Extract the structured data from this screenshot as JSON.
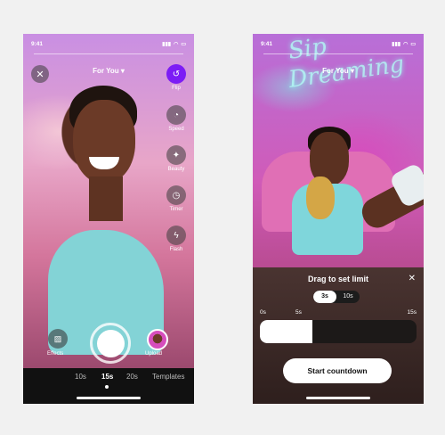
{
  "colors": {
    "accent": "#7c1cf5",
    "duration_bar": "#111111",
    "sheet_bg": "#3a2826"
  },
  "left_screen": {
    "status_time": "9:41",
    "feed_title": "For You",
    "close_icon": "close-icon",
    "tools": [
      {
        "label": "Flip",
        "icon": "flip-camera-icon",
        "glyph": "↺",
        "active": true
      },
      {
        "label": "Speed",
        "icon": "speed-gauge-icon",
        "glyph": "◔",
        "active": false
      },
      {
        "label": "Beauty",
        "icon": "magic-wand-icon",
        "glyph": "✦",
        "active": false
      },
      {
        "label": "Timer",
        "icon": "timer-icon",
        "glyph": "◷",
        "active": false
      },
      {
        "label": "Flash",
        "icon": "flash-icon",
        "glyph": "ϟ",
        "active": false
      }
    ],
    "effects_label": "Effects",
    "upload_label": "Upload",
    "durations": [
      "10s",
      "15s",
      "20s",
      "Templates"
    ],
    "selected_duration": "15s"
  },
  "right_screen": {
    "status_time": "9:41",
    "feed_title": "For You",
    "neon_text": [
      "Sip",
      "Dreaming"
    ],
    "sheet_title": "Drag to set limit",
    "close_glyph": "✕",
    "countdown_options": [
      "3s",
      "10s"
    ],
    "selected_countdown": "3s",
    "scale": {
      "start": "0s",
      "mid": "5s",
      "end": "15s"
    },
    "limit_seconds": 5,
    "limit_max_seconds": 15,
    "start_button": "Start countdown"
  }
}
